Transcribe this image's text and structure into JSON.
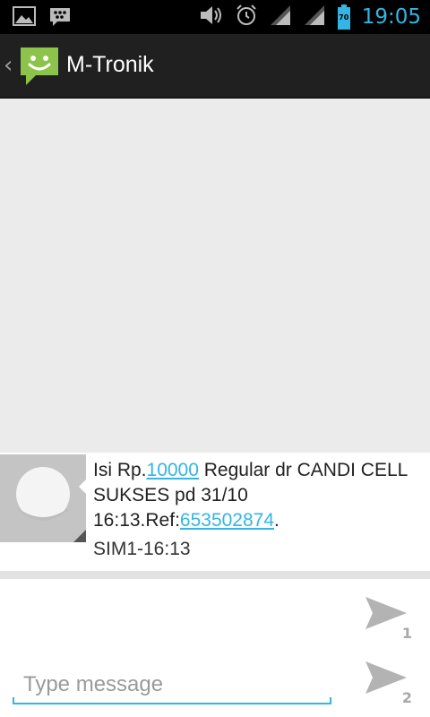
{
  "status_bar": {
    "time": "19:05",
    "battery_level": "70",
    "icons": [
      "gallery-icon",
      "bbm-icon",
      "volume-icon",
      "alarm-icon",
      "signal-sim1-icon",
      "signal-sim2-icon",
      "battery-icon"
    ]
  },
  "action_bar": {
    "title": "M-Tronik",
    "icon": "messaging-app-icon"
  },
  "message": {
    "text_prefix": "Isi Rp.",
    "amount_link": "10000",
    "text_middle": " Regular dr CANDI CELL SUKSES pd 31/10 16:13.Ref:",
    "ref_link": "653502874",
    "text_suffix": ".",
    "meta": "SIM1-16:13"
  },
  "compose": {
    "placeholder": "Type message",
    "value": "",
    "send_sim1_label": "1",
    "send_sim2_label": "2"
  },
  "colors": {
    "accent": "#33b5e5",
    "action_bar": "#202020",
    "background": "#ebebeb",
    "app_icon_green": "#8cc34a"
  }
}
